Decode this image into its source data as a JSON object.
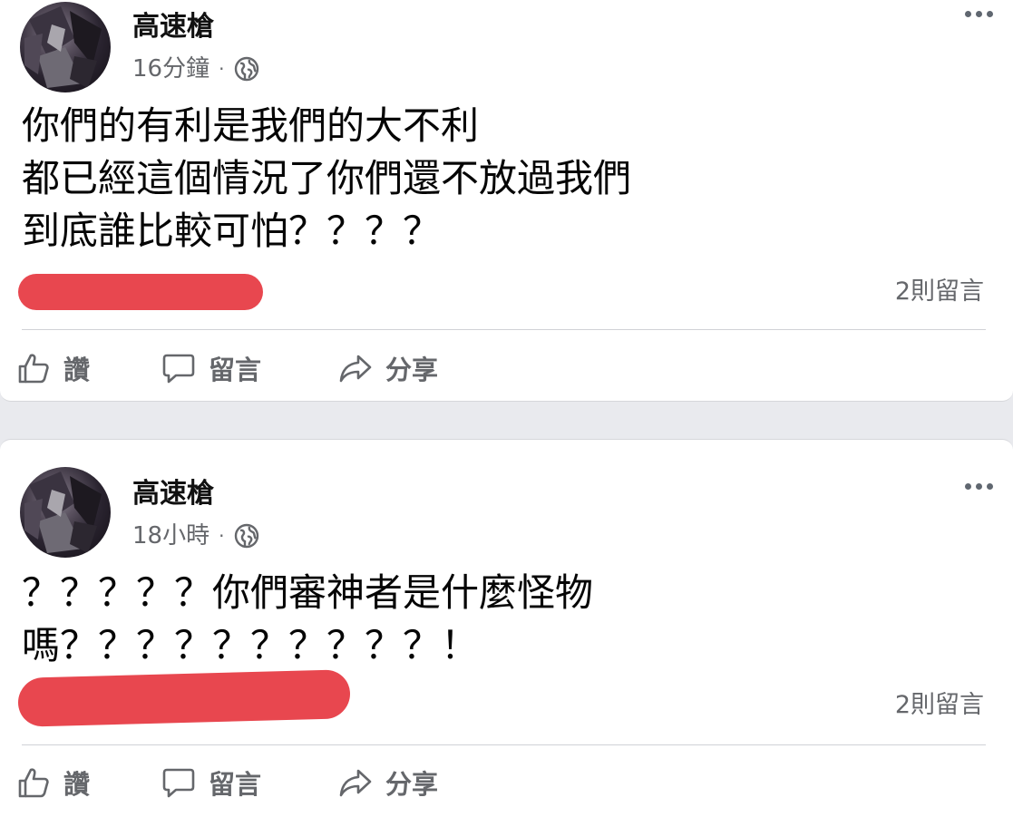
{
  "posts": [
    {
      "author": "高速槍",
      "time": "16分鐘",
      "separator": "·",
      "privacy_icon": "globe-icon",
      "lines": [
        "你們的有利是我們的大不利",
        "都已經這個情況了你們還不放過我們",
        "到底誰比較可怕？？？？"
      ],
      "comment_count": "2則留言",
      "actions": {
        "like": "讚",
        "comment": "留言",
        "share": "分享"
      }
    },
    {
      "author": "高速槍",
      "time": "18小時",
      "separator": "·",
      "privacy_icon": "globe-icon",
      "lines": [
        "？？？？？你們審神者是什麼怪物",
        "嗎？？？？？？？？？？！"
      ],
      "comment_count": "2則留言",
      "actions": {
        "like": "讚",
        "comment": "留言",
        "share": "分享"
      }
    }
  ],
  "colors": {
    "background": "#e9eaee",
    "card": "#ffffff",
    "secondary_text": "#65676b",
    "redaction": "#e8474f"
  }
}
